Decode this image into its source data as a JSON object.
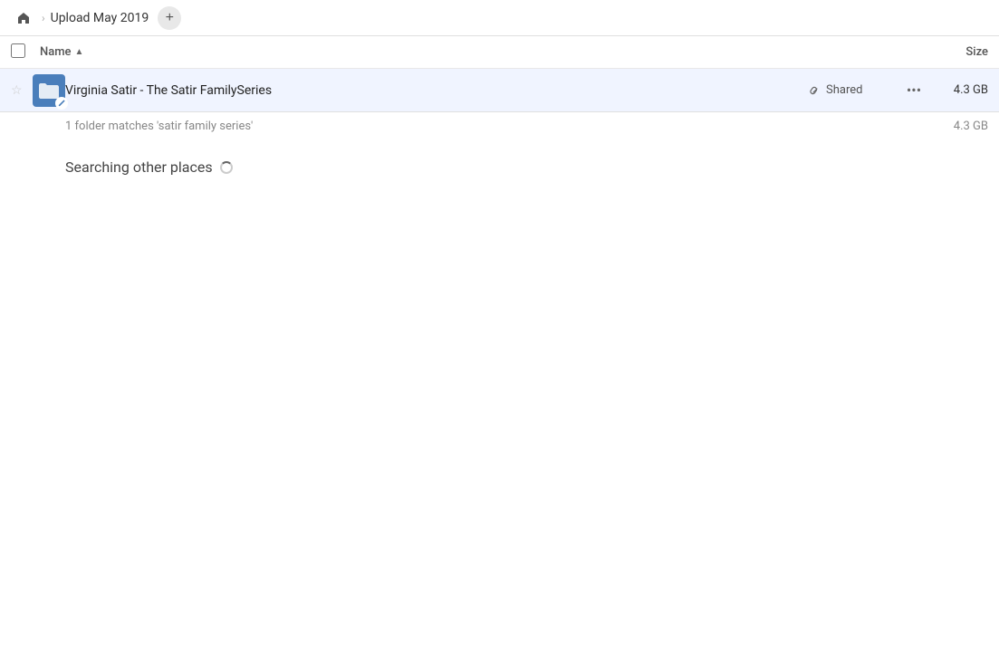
{
  "header": {
    "home_label": "Home",
    "breadcrumb_separator": "›",
    "breadcrumb_title": "Upload May 2019",
    "add_button_label": "+"
  },
  "columns": {
    "name_label": "Name",
    "size_label": "Size",
    "sort_indicator": "▲"
  },
  "file_row": {
    "folder_name": "Virginia Satir - The Satir FamilySeries",
    "shared_label": "Shared",
    "more_label": "···",
    "size": "4.3 GB"
  },
  "search_info": {
    "matches_text": "1 folder matches 'satir family series'",
    "matches_size": "4.3 GB"
  },
  "searching_section": {
    "title": "Searching other places"
  },
  "icons": {
    "home": "🏠",
    "star_empty": "☆",
    "folder": "📁",
    "link": "🔗",
    "more_dots": "···",
    "pencil": "✏"
  }
}
